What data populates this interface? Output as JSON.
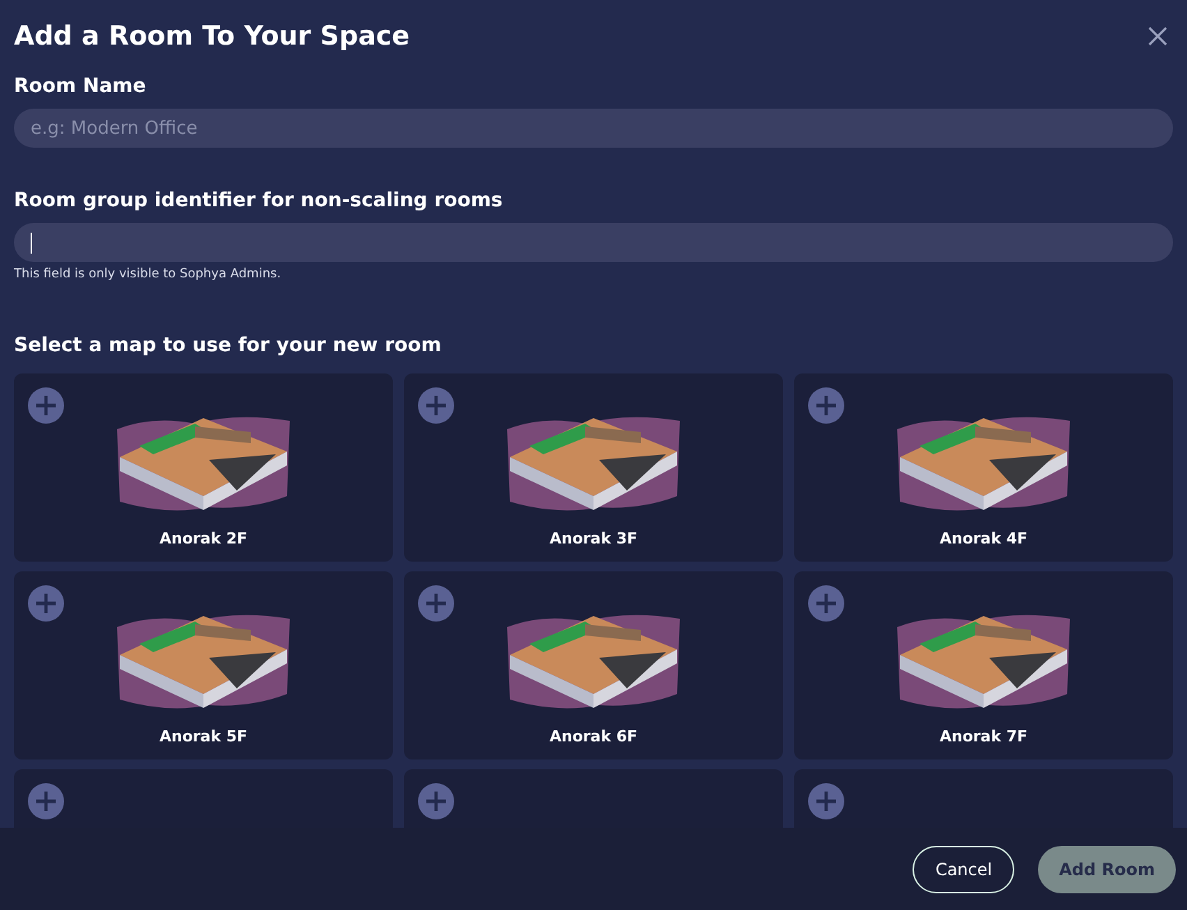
{
  "dialog": {
    "title": "Add a Room To Your Space"
  },
  "room_name": {
    "label": "Room Name",
    "placeholder": "e.g: Modern Office"
  },
  "group_identifier": {
    "label": "Room group identifier for non-scaling rooms",
    "focused": true,
    "hint": "This field is only visible to Sophya Admins."
  },
  "map_section": {
    "label": "Select a map to use for your new room"
  },
  "maps": [
    {
      "kind": "map",
      "name": "Anorak 2F"
    },
    {
      "kind": "map",
      "name": "Anorak 3F"
    },
    {
      "kind": "map",
      "name": "Anorak 4F"
    },
    {
      "kind": "map",
      "name": "Anorak 5F"
    },
    {
      "kind": "map",
      "name": "Anorak 6F"
    },
    {
      "kind": "map",
      "name": "Anorak 7F"
    },
    {
      "kind": "cut_off"
    },
    {
      "kind": "cut_off"
    },
    {
      "kind": "cut_off"
    }
  ],
  "buttons": {
    "cancel": "Cancel",
    "submit": "Add Room"
  }
}
